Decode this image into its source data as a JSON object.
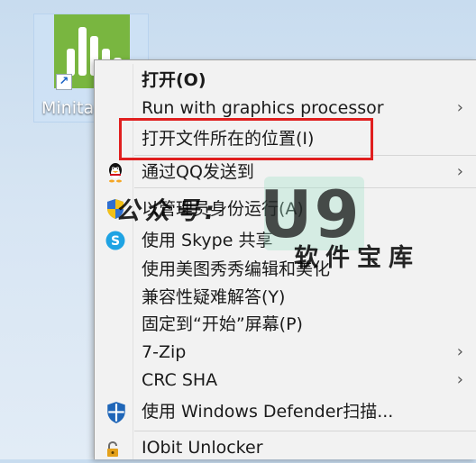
{
  "desktop": {
    "icon_label": "Minitab",
    "shortcut_glyph": "↗"
  },
  "menu": {
    "items": [
      {
        "label": "打开(O)",
        "bold": true,
        "submenu": false,
        "icon": ""
      },
      {
        "label": "Run with graphics processor",
        "bold": false,
        "submenu": true,
        "icon": ""
      },
      {
        "label": "打开文件所在的位置(I)",
        "bold": false,
        "submenu": false,
        "icon": ""
      },
      {
        "label": "通过QQ发送到",
        "bold": false,
        "submenu": true,
        "icon": "qq-penguin-icon"
      },
      {
        "label": "以管理员身份运行(A)",
        "bold": false,
        "submenu": false,
        "icon": "uac-shield-icon"
      },
      {
        "label": "使用 Skype 共享",
        "bold": false,
        "submenu": false,
        "icon": "skype-icon"
      },
      {
        "label": "使用美图秀秀编辑和美化",
        "bold": false,
        "submenu": false,
        "icon": ""
      },
      {
        "label": "兼容性疑难解答(Y)",
        "bold": false,
        "submenu": false,
        "icon": ""
      },
      {
        "label": "固定到“开始”屏幕(P)",
        "bold": false,
        "submenu": false,
        "icon": ""
      },
      {
        "label": "7-Zip",
        "bold": false,
        "submenu": true,
        "icon": ""
      },
      {
        "label": "CRC SHA",
        "bold": false,
        "submenu": true,
        "icon": ""
      },
      {
        "label": "使用 Windows Defender扫描...",
        "bold": false,
        "submenu": false,
        "icon": "defender-icon"
      },
      {
        "label": "IObit Unlocker",
        "bold": false,
        "submenu": false,
        "icon": "lock-icon"
      }
    ],
    "arrow": "›"
  },
  "watermark": {
    "line1": "公众号:",
    "logo": "U9",
    "line2": "软件宝库"
  },
  "colors": {
    "highlight_border": "#e01f1f",
    "app_tile": "#79b640",
    "menu_bg": "#f2f2f2"
  }
}
